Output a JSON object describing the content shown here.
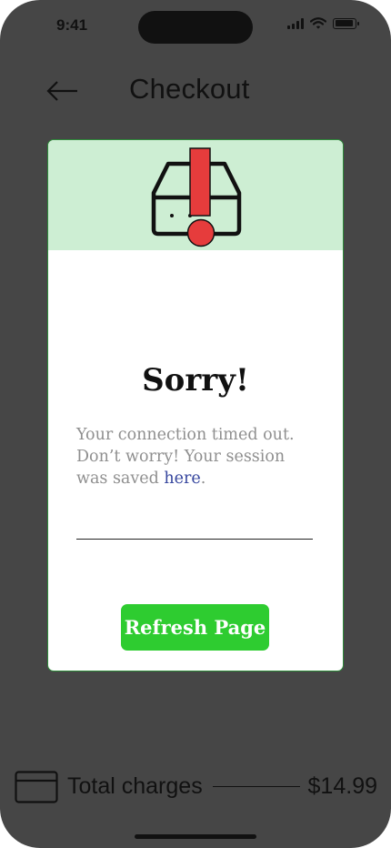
{
  "status_bar": {
    "time": "9:41"
  },
  "header": {
    "title": "Checkout",
    "back_icon": "arrow-left-icon"
  },
  "card": {
    "banner_icon": "inbox-alert-icon",
    "heading": "Sorry!",
    "message_text": "Your connection timed out. Don’t worry! Your session was saved ",
    "message_link": "here",
    "message_end": ".",
    "input_value": "",
    "button_label": "Refresh Page"
  },
  "footer": {
    "icon": "credit-card-icon",
    "label": "Total charges",
    "amount": "$14.99"
  },
  "colors": {
    "background": "#464646",
    "banner": "#cdeed3",
    "button": "#2ecc30",
    "alert_red": "#e63c3c",
    "link": "#36469e"
  }
}
